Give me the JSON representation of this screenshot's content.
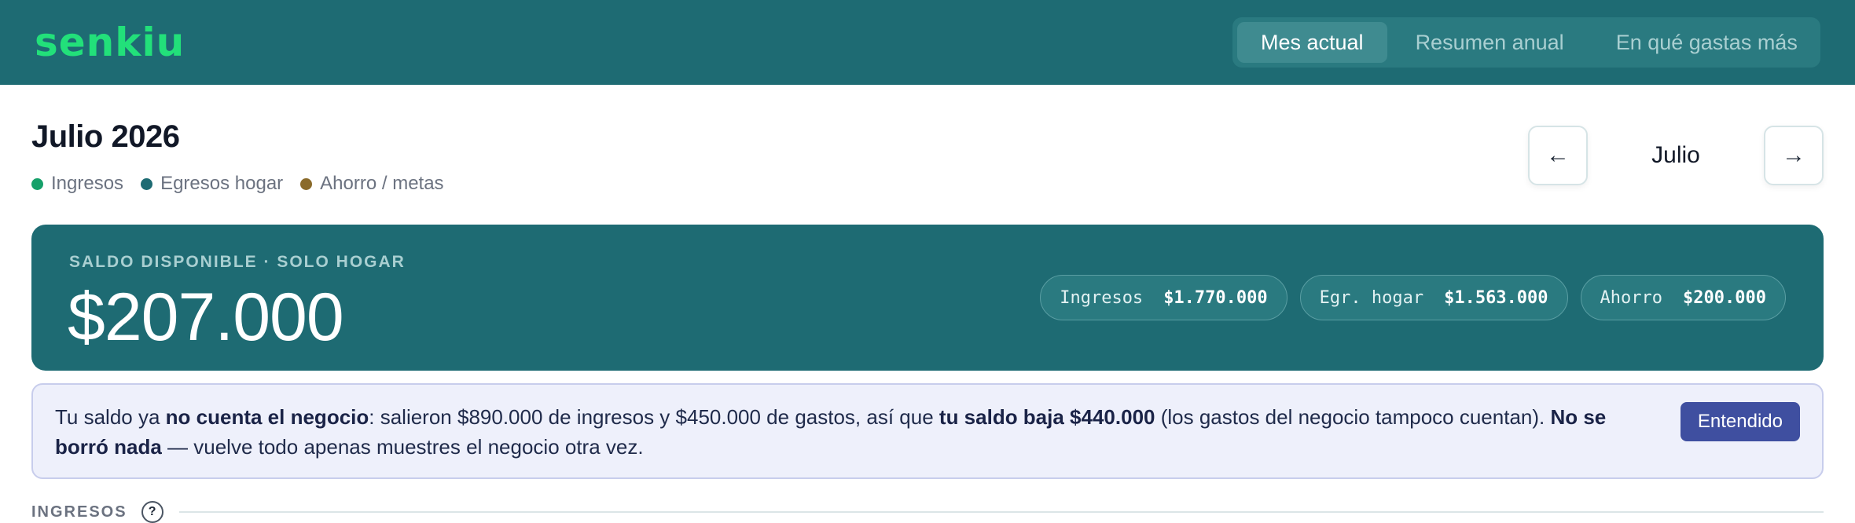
{
  "app": {
    "logo": "senkiu",
    "logo_color": "#22e07a",
    "header_color": "#1e6b73"
  },
  "nav": {
    "tabs": [
      {
        "label": "Mes actual",
        "active": true
      },
      {
        "label": "Resumen anual",
        "active": false
      },
      {
        "label": "En qué gastas más",
        "active": false
      }
    ]
  },
  "month": {
    "title": "Julio 2026",
    "current_label": "Julio",
    "prev_arrow": "←",
    "next_arrow": "→",
    "legend": [
      {
        "label": "Ingresos",
        "color": "#16a06a"
      },
      {
        "label": "Egresos hogar",
        "color": "#1e6b73"
      },
      {
        "label": "Ahorro / metas",
        "color": "#8a6a2a"
      }
    ]
  },
  "balance": {
    "label": "SALDO DISPONIBLE · SOLO HOGAR",
    "amount": "$207.000",
    "chips": [
      {
        "label": "Ingresos",
        "value": "$1.770.000"
      },
      {
        "label": "Egr. hogar",
        "value": "$1.563.000"
      },
      {
        "label": "Ahorro",
        "value": "$200.000"
      }
    ]
  },
  "notice": {
    "segments": [
      {
        "text": "Tu saldo ya ",
        "bold": false
      },
      {
        "text": "no cuenta el negocio",
        "bold": true
      },
      {
        "text": ": salieron $890.000 de ingresos y $450.000 de gastos, así que ",
        "bold": false
      },
      {
        "text": "tu saldo baja $440.000",
        "bold": true
      },
      {
        "text": " (los gastos del negocio tampoco cuentan). ",
        "bold": false
      },
      {
        "text": "No se borró nada",
        "bold": true
      },
      {
        "text": " — vuelve todo apenas muestres el negocio otra vez.",
        "bold": false
      }
    ],
    "button_label": "Entendido"
  },
  "section": {
    "title": "INGRESOS",
    "help_icon": "?"
  }
}
